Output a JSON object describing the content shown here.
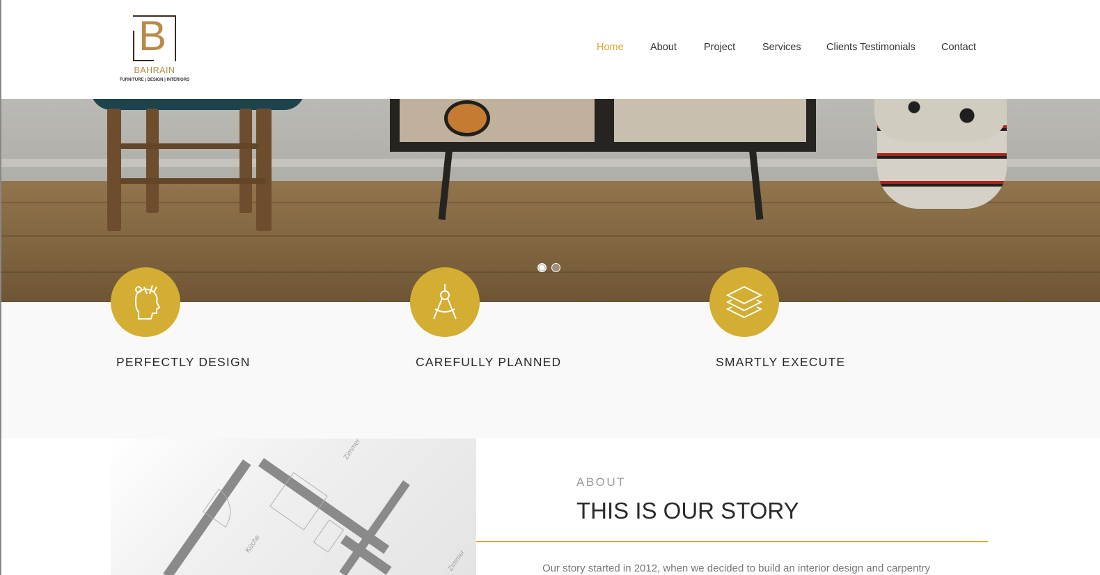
{
  "brand": {
    "letter": "B",
    "name": "BAHRAIN",
    "tagline": "FURNITURE | DESIGN | INTERIORS",
    "color": "#b88a4a"
  },
  "nav": {
    "items": [
      {
        "label": "Home",
        "active": true
      },
      {
        "label": "About",
        "active": false
      },
      {
        "label": "Project",
        "active": false
      },
      {
        "label": "Services",
        "active": false
      },
      {
        "label": "Clients Testimonials",
        "active": false
      },
      {
        "label": "Contact",
        "active": false
      }
    ],
    "active_color": "#d4a628"
  },
  "slider": {
    "slide_count": 2,
    "active_slide": 1
  },
  "features": [
    {
      "title": "PERFECTLY DESIGN",
      "icon": "head-tools-icon"
    },
    {
      "title": "CAREFULLY PLANNED",
      "icon": "compass-icon"
    },
    {
      "title": "SMARTLY EXECUTE",
      "icon": "layers-icon"
    }
  ],
  "accent_color": "#d4ad33",
  "about": {
    "kicker": "ABOUT",
    "title": "THIS IS OUR STORY",
    "text": "Our story started in 2012, when we decided to build an interior design and carpentry",
    "blueprint_labels": [
      "Küche",
      "Zimmer",
      "Zimmer"
    ]
  }
}
